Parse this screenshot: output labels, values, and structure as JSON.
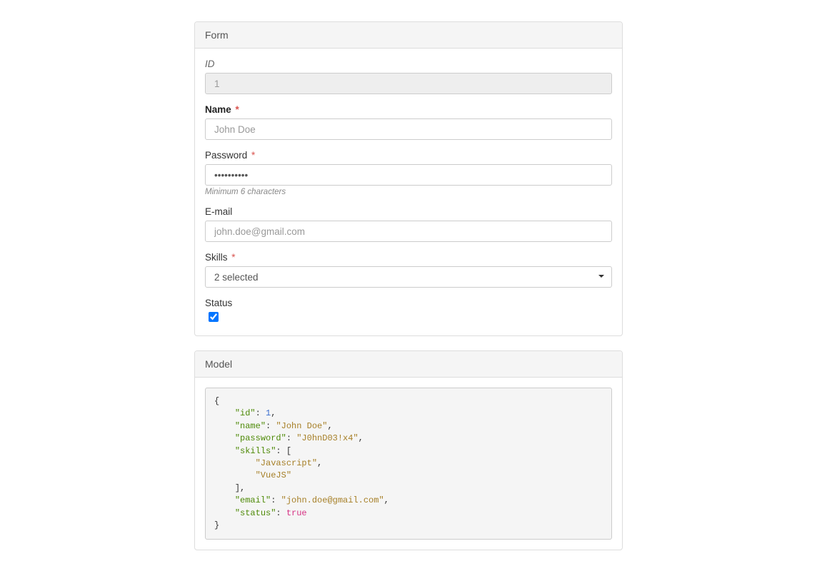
{
  "form_panel": {
    "title": "Form",
    "fields": {
      "id": {
        "label": "ID",
        "value": "1"
      },
      "name": {
        "label": "Name",
        "required": "*",
        "placeholder": "John Doe"
      },
      "password": {
        "label": "Password",
        "required": "*",
        "value": "••••••••••",
        "hint": "Minimum 6 characters"
      },
      "email": {
        "label": "E-mail",
        "placeholder": "john.doe@gmail.com"
      },
      "skills": {
        "label": "Skills",
        "required": "*",
        "display": "2 selected"
      },
      "status": {
        "label": "Status",
        "checked": true
      }
    }
  },
  "model_panel": {
    "title": "Model",
    "json": {
      "id": 1,
      "name": "John Doe",
      "password": "J0hnD03!x4",
      "skills": [
        "Javascript",
        "VueJS"
      ],
      "email": "john.doe@gmail.com",
      "status": true
    }
  }
}
